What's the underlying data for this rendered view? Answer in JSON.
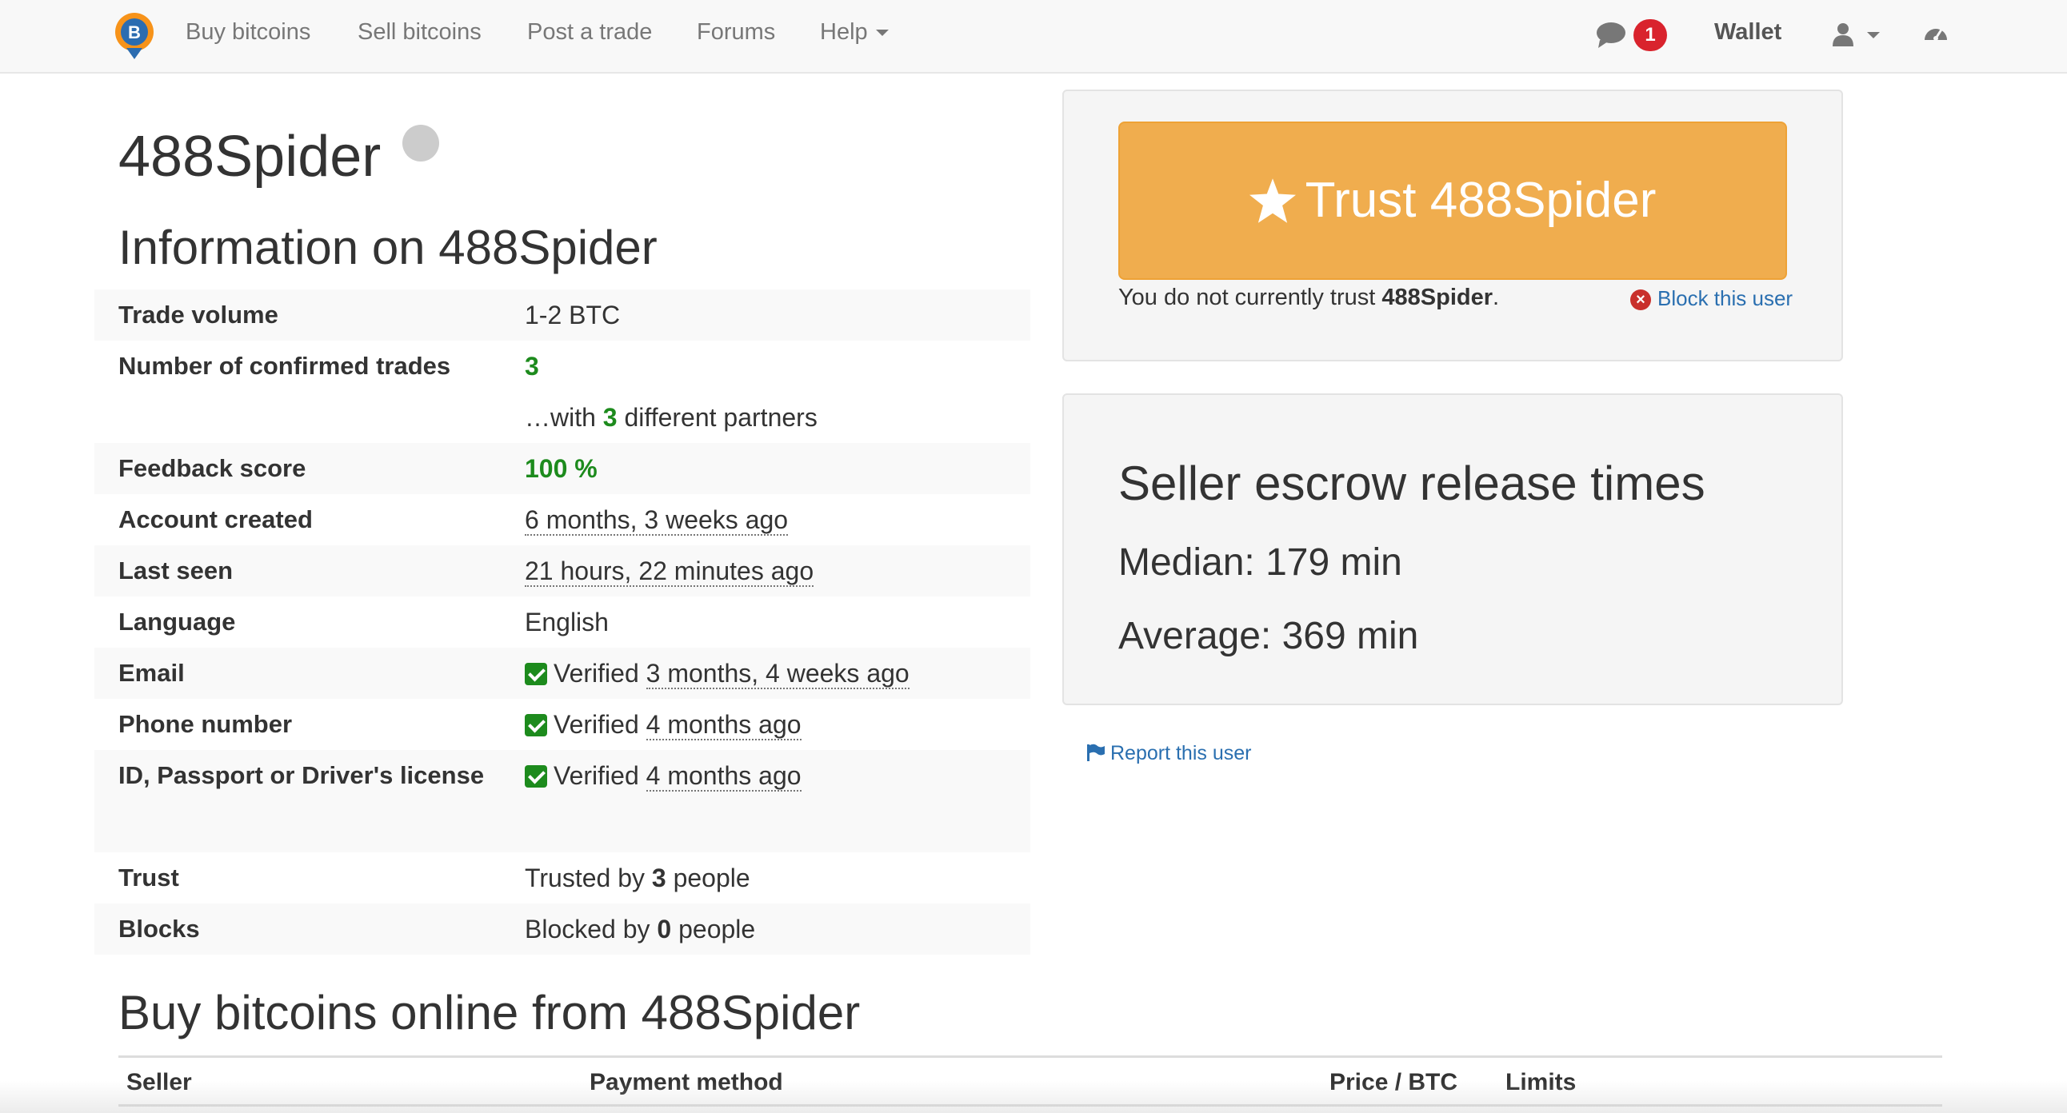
{
  "nav": {
    "logo": "bitcoin-logo-icon",
    "links": [
      "Buy bitcoins",
      "Sell bitcoins",
      "Post a trade",
      "Forums",
      "Help"
    ],
    "notification_count": "1",
    "wallet": "Wallet",
    "icons": [
      "chat-icon",
      "user-icon",
      "dashboard-icon"
    ]
  },
  "profile": {
    "username": "488Spider",
    "info_heading": "Information on 488Spider",
    "rows": {
      "trade_volume": {
        "label": "Trade volume",
        "value": "1-2 BTC"
      },
      "confirmed_trades": {
        "label": "Number of confirmed trades",
        "value": "3"
      },
      "partners": {
        "prefix": "…with ",
        "count": "3",
        "suffix": " different partners"
      },
      "feedback": {
        "label": "Feedback score",
        "value": "100 %"
      },
      "account_created": {
        "label": "Account created",
        "value": "6 months, 3 weeks ago"
      },
      "last_seen": {
        "label": "Last seen",
        "value": "21 hours, 22 minutes ago"
      },
      "language": {
        "label": "Language",
        "value": "English"
      },
      "email": {
        "label": "Email",
        "status": "Verified",
        "when": "3 months, 4 weeks ago"
      },
      "phone": {
        "label": "Phone number",
        "status": "Verified",
        "when": "4 months ago"
      },
      "id": {
        "label": "ID, Passport or Driver's license",
        "status": "Verified",
        "when": "4 months ago"
      },
      "trust": {
        "label": "Trust",
        "prefix": "Trusted by ",
        "count": "3",
        "suffix": " people"
      },
      "blocks": {
        "label": "Blocks",
        "prefix": "Blocked by ",
        "count": "0",
        "suffix": " people"
      }
    },
    "buy_heading": "Buy bitcoins online from 488Spider",
    "offers_columns": [
      "Seller",
      "Payment method",
      "Price / BTC",
      "Limits"
    ]
  },
  "sidebar": {
    "trust_button": "Trust 488Spider",
    "trust_note_prefix": "You do not currently trust ",
    "trust_note_name": "488Spider",
    "trust_note_suffix": ".",
    "block_link": "Block this user",
    "escrow_heading": "Seller escrow release times",
    "median": "Median: 179 min",
    "average": "Average: 369 min",
    "report_link": "Report this user"
  },
  "colors": {
    "accent_orange": "#f0ad4e",
    "verified_green": "#1d8b1d",
    "link_blue": "#2a6fb0",
    "badge_red": "#d9232d"
  }
}
